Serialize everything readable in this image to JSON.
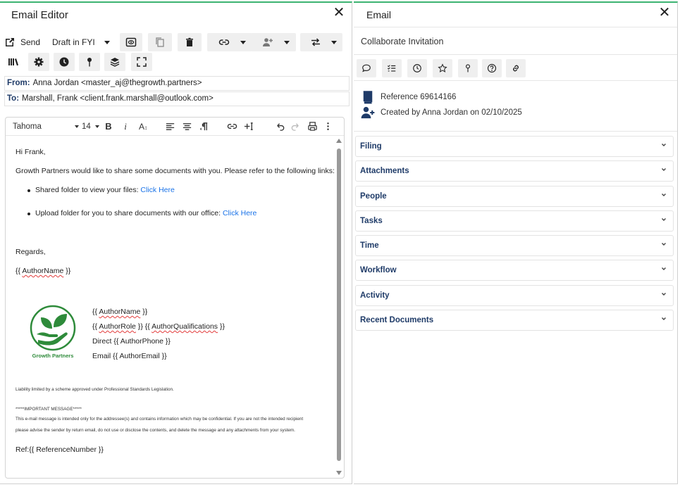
{
  "editor": {
    "title": "Email Editor",
    "toolbar": {
      "send_label": "Send",
      "status_label": "Draft in FYI"
    },
    "from_label": "From:",
    "from_value": "Anna Jordan <master_aj@thegrowth.partners>",
    "to_label": "To:",
    "to_value": "Marshall, Frank <client.frank.marshall@outlook.com>",
    "format": {
      "font": "Tahoma",
      "size": "14"
    },
    "body": {
      "greeting": "Hi Frank,",
      "intro": "Growth Partners would like to share some documents with you. Please refer to the following links:",
      "bullet1_text": "Shared folder to view your files: ",
      "bullet1_link": "Click Here",
      "bullet2_text": "Upload folder for you to share documents with our office: ",
      "bullet2_link": "Click Here",
      "regards": "Regards,",
      "author_name": "{{ AuthorName }}",
      "sig_name": "{{ AuthorName }}",
      "sig_role": "{{ AuthorRole }} {{ AuthorQualifications }}",
      "sig_direct": "Direct {{ AuthorPhone }}",
      "sig_email": "Email {{ AuthorEmail }}",
      "logo_text": "Growth Partners",
      "liability": "Liability limited by a scheme approved under Professional Standards Legislation.",
      "important": "*****IMPORTANT MESSAGE*****",
      "disclaimer1": "This e-mail message is intended only for the addressee(s) and contains information which may be confidential.  If you are not the intended recipient",
      "disclaimer2": "please advise the sender by return email, do not use or disclose the contents, and delete the message and any attachments from your system.",
      "ref": "Ref:{{ ReferenceNumber }}"
    }
  },
  "panel": {
    "title": "Email",
    "subject": "Collaborate Invitation",
    "reference": "Reference 69614166",
    "created": "Created by Anna Jordan on 02/10/2025",
    "sections": [
      "Filing",
      "Attachments",
      "People",
      "Tasks",
      "Time",
      "Workflow",
      "Activity",
      "Recent Documents"
    ]
  },
  "colors": {
    "accent_green": "#3cb371",
    "link_blue": "#1a73e8",
    "section_label": "#1f3b68",
    "logo_green": "#2e8b3a"
  }
}
